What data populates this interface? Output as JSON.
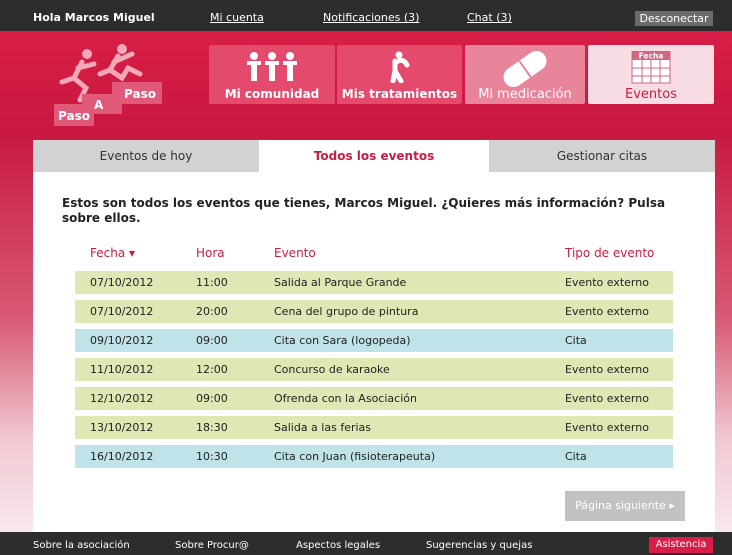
{
  "topbar": {
    "greeting": "Hola Marcos Miguel",
    "account": "Mi cuenta",
    "notifications": "Notificaciones (3)",
    "chat": "Chat (3)",
    "logout": "Desconectar"
  },
  "logo": {
    "line1": "Paso",
    "line2": "A",
    "line3": "Paso"
  },
  "nav": [
    {
      "label": "Mi comunidad",
      "icon": "people-icon"
    },
    {
      "label": "Mis tratamientos",
      "icon": "exercise-icon"
    },
    {
      "label": "Mi medicación",
      "icon": "pill-icon"
    },
    {
      "label": "Eventos",
      "icon": "calendar-icon",
      "icon_text": "Fecha"
    }
  ],
  "tabs": [
    "Eventos de hoy",
    "Todos los eventos",
    "Gestionar citas"
  ],
  "intro": "Estos son todos los eventos que tienes, Marcos Miguel. ¿Quieres más información? Pulsa sobre ellos.",
  "table": {
    "headers": [
      "Fecha ▾",
      "Hora",
      "Evento",
      "Tipo de evento"
    ],
    "rows": [
      [
        "07/10/2012",
        "11:00",
        "Salida al Parque Grande",
        "Evento externo"
      ],
      [
        "07/10/2012",
        "20:00",
        "Cena del grupo de pintura",
        "Evento externo"
      ],
      [
        "09/10/2012",
        "09:00",
        "Cita con Sara (logopeda)",
        "Cita"
      ],
      [
        "11/10/2012",
        "12:00",
        "Concurso de karaoke",
        "Evento externo"
      ],
      [
        "12/10/2012",
        "09:00",
        "Ofrenda con la Asociación",
        "Evento externo"
      ],
      [
        "13/10/2012",
        "18:30",
        "Salida a las ferias",
        "Evento externo"
      ],
      [
        "16/10/2012",
        "10:30",
        "Cita con Juan (fisioterapeuta)",
        "Cita"
      ]
    ]
  },
  "next_button": "Página siguiente ▸",
  "footer": {
    "about": "Sobre la asociación",
    "procura": "Sobre Procur@",
    "legal": "Aspectos legales",
    "suggestions": "Sugerencias y quejas",
    "help": "Asistencia"
  },
  "colors": {
    "brand": "#c91c42",
    "row_external": "#dfe8b5",
    "row_cita": "#bfe3e8"
  }
}
